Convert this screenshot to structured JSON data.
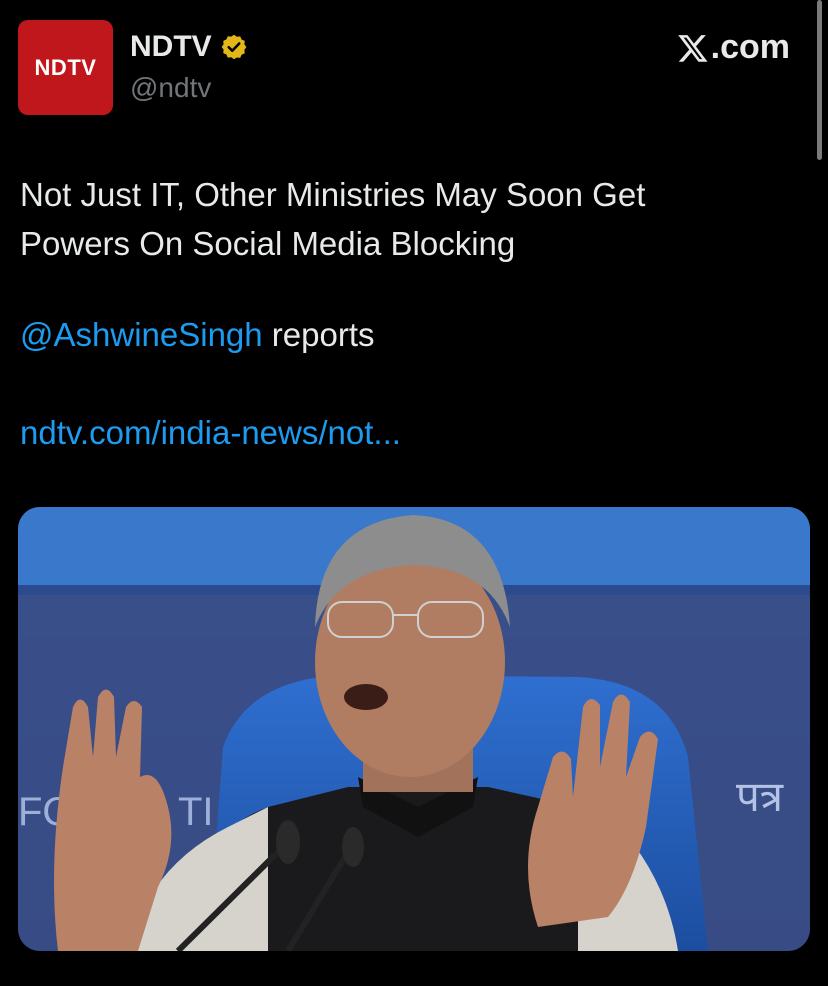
{
  "account": {
    "avatar_text": "NDTV",
    "display_name": "NDTV",
    "handle": "@ndtv",
    "verified_icon": "gold-verified-badge"
  },
  "site": {
    "label": ".com",
    "icon": "x-logo-icon"
  },
  "tweet": {
    "headline_line1": "Not Just IT, Other Ministries May Soon Get",
    "headline_line2": "Powers On Social Media Blocking",
    "mention": "@AshwineSingh",
    "mention_suffix": " reports",
    "link": "ndtv.com/india-news/not..."
  },
  "media": {
    "backdrop_text_left": "FO",
    "backdrop_text_mid": "TI",
    "backdrop_text_right": "पत्र"
  },
  "colors": {
    "background": "#000000",
    "text": "#e7e9ea",
    "muted": "#71767b",
    "link": "#1d9bf0",
    "avatar": "#c0171c",
    "verified": "#e2b719"
  }
}
